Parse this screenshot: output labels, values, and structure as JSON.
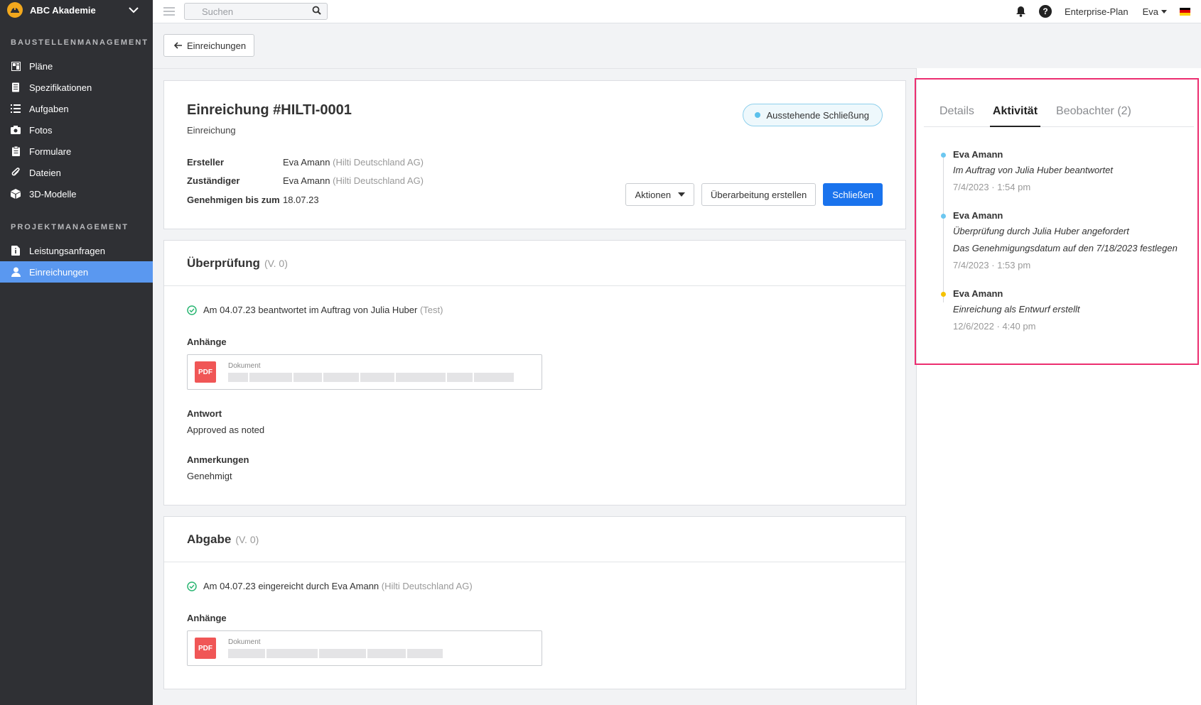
{
  "sidebar": {
    "brand": "ABC Akademie",
    "section1_title": "BAUSTELLENMANAGEMENT",
    "section1_items": [
      {
        "label": "Pläne",
        "icon": "plans-icon"
      },
      {
        "label": "Spezifikationen",
        "icon": "specifications-icon"
      },
      {
        "label": "Aufgaben",
        "icon": "tasks-icon"
      },
      {
        "label": "Fotos",
        "icon": "camera-icon"
      },
      {
        "label": "Formulare",
        "icon": "clipboard-icon"
      },
      {
        "label": "Dateien",
        "icon": "paperclip-icon"
      },
      {
        "label": "3D-Modelle",
        "icon": "cube-icon"
      }
    ],
    "section2_title": "PROJEKTMANAGEMENT",
    "section2_items": [
      {
        "label": "Leistungsanfragen",
        "icon": "document-info-icon"
      },
      {
        "label": "Einreichungen",
        "icon": "person-icon",
        "active": true
      }
    ]
  },
  "topbar": {
    "search_placeholder": "Suchen",
    "plan": "Enterprise-Plan",
    "user": "Eva",
    "help": "?"
  },
  "back_button": "Einreichungen",
  "submission": {
    "title": "Einreichung #HILTI-0001",
    "type": "Einreichung",
    "status": "Ausstehende Schließung",
    "creator_label": "Ersteller",
    "creator": "Eva Amann",
    "creator_company": "(Hilti Deutschland AG)",
    "assignee_label": "Zuständiger",
    "assignee": "Eva Amann",
    "assignee_company": "(Hilti Deutschland AG)",
    "approve_by_label": "Genehmigen bis zum",
    "approve_by": "18.07.23",
    "actions_label": "Aktionen",
    "revise_label": "Überarbeitung erstellen",
    "close_label": "Schließen"
  },
  "review": {
    "title": "Überprüfung",
    "version": "(V. 0)",
    "answered": "Am 04.07.23 beantwortet im Auftrag von Julia Huber",
    "answered_note": "(Test)",
    "attachments_label": "Anhänge",
    "attachment_type": "PDF",
    "attachment_label": "Dokument",
    "answer_label": "Antwort",
    "answer": "Approved as noted",
    "remarks_label": "Anmerkungen",
    "remarks": "Genehmigt"
  },
  "delivery": {
    "title": "Abgabe",
    "version": "(V. 0)",
    "submitted": "Am 04.07.23 eingereicht durch Eva Amann",
    "submitted_company": "(Hilti Deutschland AG)",
    "attachments_label": "Anhänge",
    "attachment_type": "PDF",
    "attachment_label": "Dokument"
  },
  "panel": {
    "tabs": [
      {
        "label": "Details"
      },
      {
        "label": "Aktivität",
        "active": true
      },
      {
        "label": "Beobachter",
        "count": "(2)"
      }
    ],
    "activity": [
      {
        "name": "Eva Amann",
        "lines": [
          "Im Auftrag von Julia Huber beantwortet"
        ],
        "date": "7/4/2023",
        "sep": "·",
        "time": "1:54 pm",
        "dot": "#6cc7f0"
      },
      {
        "name": "Eva Amann",
        "lines": [
          "Überprüfung durch Julia Huber angefordert",
          "Das Genehmigungsdatum auf den 7/18/2023 festlegen"
        ],
        "date": "7/4/2023",
        "sep": "·",
        "time": "1:53 pm",
        "dot": "#6cc7f0"
      },
      {
        "name": "Eva Amann",
        "lines": [
          "Einreichung als Entwurf erstellt"
        ],
        "date": "12/6/2022",
        "sep": "·",
        "time": "4:40 pm",
        "dot": "#f5c200"
      }
    ]
  },
  "colors": {
    "sidebar_bg": "#2f3034",
    "active_nav": "#5a98f0",
    "primary": "#1a73ed",
    "highlight": "#ec2e70",
    "pdf": "#f05656",
    "success": "#2bb673"
  }
}
